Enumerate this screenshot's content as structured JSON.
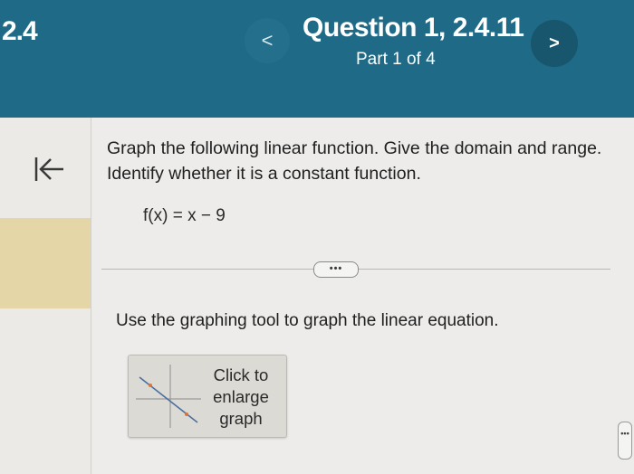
{
  "header": {
    "section": "2.4",
    "title": "Question 1, 2.4.11",
    "part": "Part 1 of 4",
    "prev_symbol": "<",
    "next_symbol": ">"
  },
  "question": {
    "prompt": "Graph the following linear function. Give the domain and range. Identify whether it is a constant function.",
    "function": "f(x) = x − 9"
  },
  "more_label": "•••",
  "instruction": "Use the graphing tool to graph the linear equation.",
  "graph_button": {
    "label_line1": "Click to",
    "label_line2": "enlarge",
    "label_line3": "graph"
  },
  "side_tab_label": "•••",
  "icons": {
    "collapse": "collapse-left-icon",
    "prev": "chevron-left-icon",
    "next": "chevron-right-icon"
  },
  "colors": {
    "header": "#1f6a86",
    "accent_highlight": "#e5d6a8"
  }
}
